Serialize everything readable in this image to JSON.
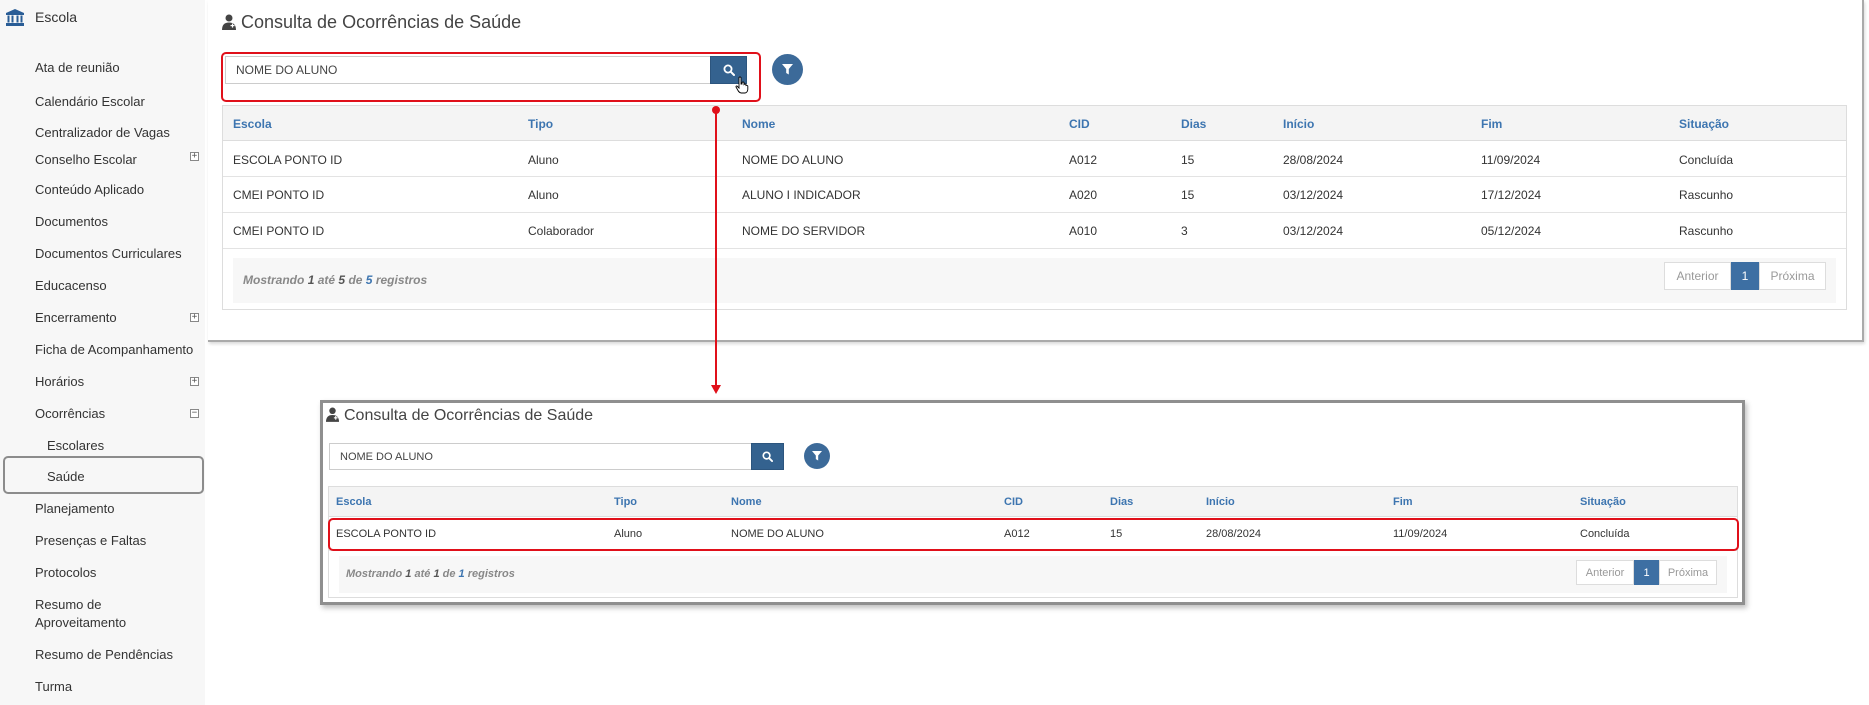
{
  "sidebar": {
    "title": "Escola",
    "items": [
      {
        "label": "Ata de reunião"
      },
      {
        "label": "Calendário Escolar"
      },
      {
        "label": "Centralizador de Vagas"
      },
      {
        "label": "Conselho Escolar"
      },
      {
        "label": "Conteúdo Aplicado"
      },
      {
        "label": "Documentos"
      },
      {
        "label": "Documentos Curriculares"
      },
      {
        "label": "Educacenso"
      },
      {
        "label": "Encerramento"
      },
      {
        "label": "Ficha de Acompanhamento"
      },
      {
        "label": "Horários"
      },
      {
        "label": "Ocorrências"
      },
      {
        "label": "Escolares"
      },
      {
        "label": "Saúde"
      },
      {
        "label": "Planejamento"
      },
      {
        "label": "Presenças e Faltas"
      },
      {
        "label": "Protocolos"
      },
      {
        "label": "Resumo de"
      },
      {
        "label": "Aproveitamento"
      },
      {
        "label": "Resumo de Pendências"
      },
      {
        "label": "Turma"
      }
    ],
    "selected": "Saúde"
  },
  "panel_before": {
    "title": "Consulta de Ocorrências de Saúde",
    "search_value": "NOME DO ALUNO",
    "columns": [
      "Escola",
      "Tipo",
      "Nome",
      "CID",
      "Dias",
      "Início",
      "Fim",
      "Situação"
    ],
    "rows": [
      [
        "ESCOLA PONTO ID",
        "Aluno",
        "NOME DO ALUNO",
        "A012",
        "15",
        "28/08/2024",
        "11/09/2024",
        "Concluída"
      ],
      [
        "CMEI PONTO ID",
        "Aluno",
        "ALUNO I INDICADOR",
        "A020",
        "15",
        "03/12/2024",
        "17/12/2024",
        "Rascunho"
      ],
      [
        "CMEI PONTO ID",
        "Colaborador",
        "NOME DO SERVIDOR",
        "A010",
        "3",
        "03/12/2024",
        "05/12/2024",
        "Rascunho"
      ]
    ],
    "footer": {
      "w1": "Mostrando",
      "a": "1",
      "w2": "até",
      "b": "5",
      "w3": "de",
      "c": "5",
      "w4": "registros"
    },
    "pager": {
      "prev": "Anterior",
      "page": "1",
      "next": "Próxima"
    }
  },
  "panel_after": {
    "title": "Consulta de Ocorrências de Saúde",
    "search_value": "NOME DO ALUNO",
    "columns": [
      "Escola",
      "Tipo",
      "Nome",
      "CID",
      "Dias",
      "Início",
      "Fim",
      "Situação"
    ],
    "rows": [
      [
        "ESCOLA PONTO ID",
        "Aluno",
        "NOME DO ALUNO",
        "A012",
        "15",
        "28/08/2024",
        "11/09/2024",
        "Concluída"
      ]
    ],
    "footer": {
      "w1": "Mostrando",
      "a": "1",
      "w2": "até",
      "b": "1",
      "w3": "de",
      "c": "1",
      "w4": "registros"
    },
    "pager": {
      "prev": "Anterior",
      "page": "1",
      "next": "Próxima"
    }
  },
  "colors": {
    "accent": "#3d75b0",
    "button": "#34628f",
    "highlight": "#e0101a",
    "sidebar_icon": "#2a5d96"
  },
  "icons": {
    "sidebar_title": "bank-icon",
    "panel_title": "user-medical-icon",
    "search": "search-icon",
    "filter": "filter-icon",
    "cursor": "hand-cursor-icon"
  }
}
